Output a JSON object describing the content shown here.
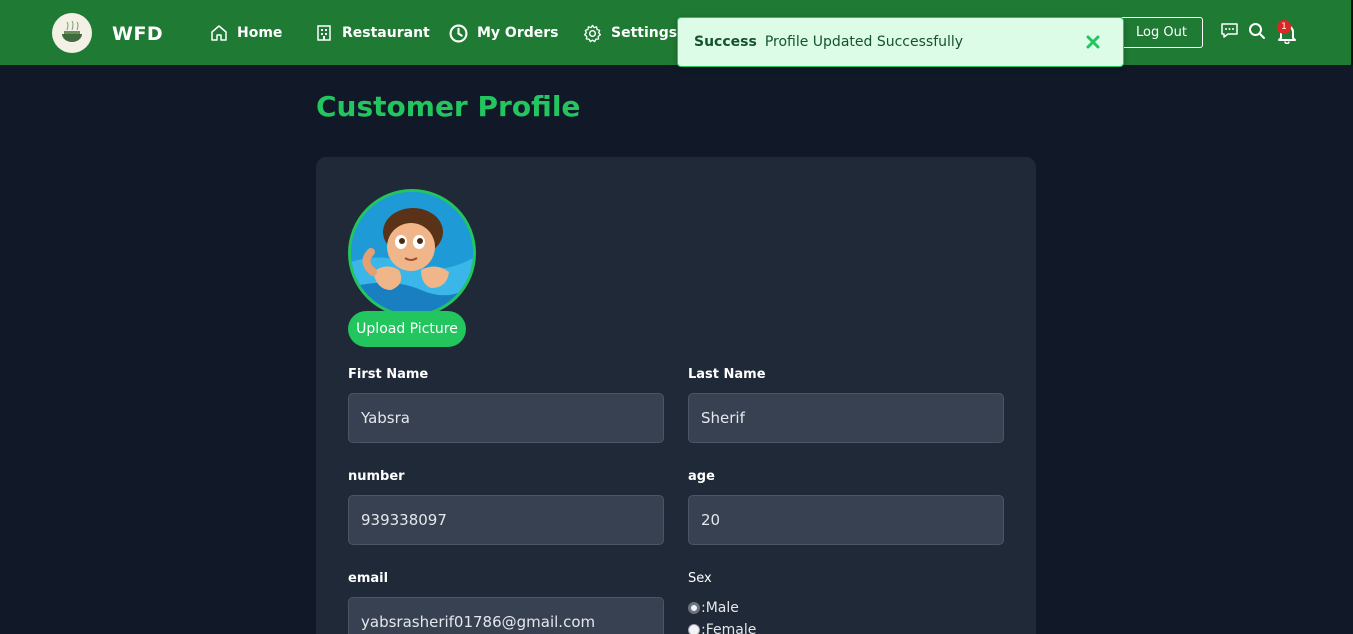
{
  "navbar": {
    "brand": "WFD",
    "items": [
      {
        "label": "Home",
        "icon": "home-icon"
      },
      {
        "label": "Restaurant",
        "icon": "building-icon"
      },
      {
        "label": "My Orders",
        "icon": "clock-icon"
      },
      {
        "label": "Settings",
        "icon": "gear-icon"
      }
    ],
    "logout_label": "Log Out",
    "notification_count": "1",
    "bg_color": "#1f7a34"
  },
  "toast": {
    "title": "Success",
    "message": "Profile Updated Successfully"
  },
  "page": {
    "title": "Customer Profile",
    "accent_color": "#22c55e"
  },
  "profile": {
    "upload_label": "Upload Picture",
    "fields": {
      "first_name": {
        "label": "First Name",
        "value": "Yabsra"
      },
      "last_name": {
        "label": "Last Name",
        "value": "Sherif"
      },
      "number": {
        "label": "number",
        "value": "939338097"
      },
      "age": {
        "label": "age",
        "value": "20"
      },
      "email": {
        "label": "email",
        "value": "yabsrasherif01786@gmail.com"
      }
    },
    "sex": {
      "label": "Sex",
      "options": [
        {
          "label": ":Male",
          "checked": true
        },
        {
          "label": ":Female",
          "checked": false
        }
      ]
    }
  }
}
